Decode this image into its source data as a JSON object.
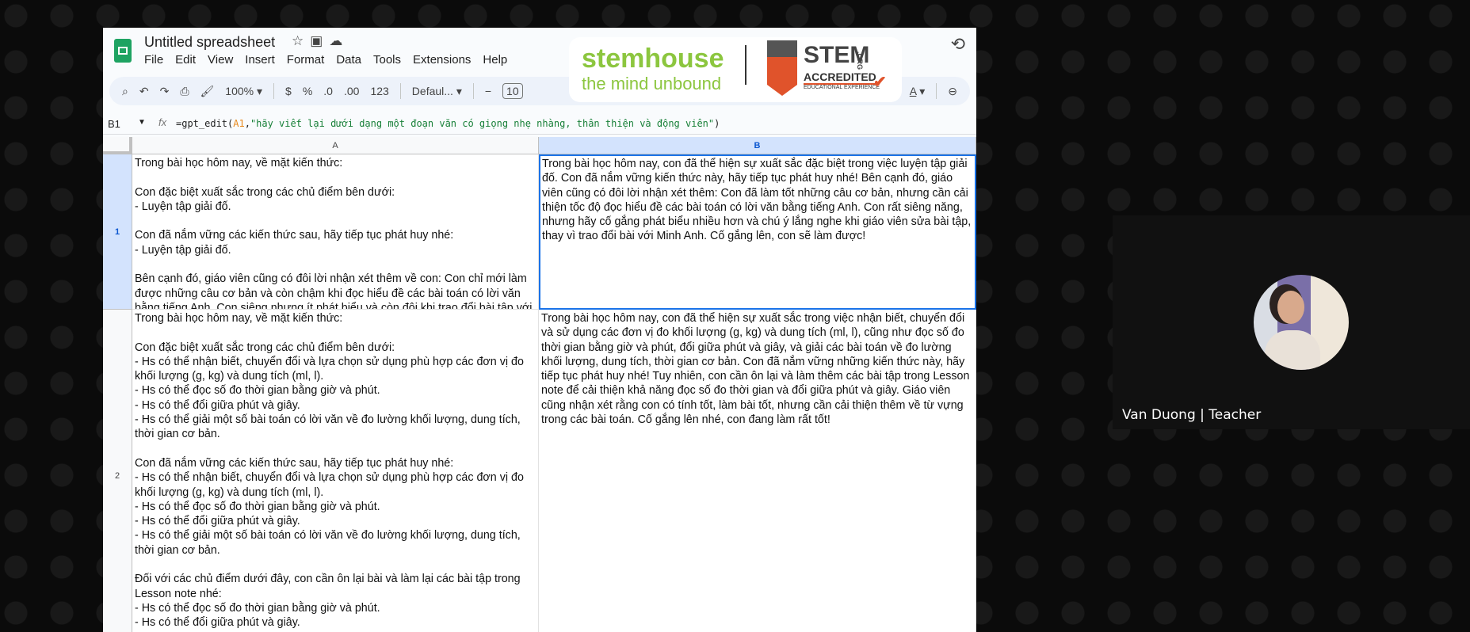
{
  "app": {
    "title": "Untitled spreadsheet",
    "title_icons": [
      "star-icon",
      "folder-move-icon",
      "cloud-status-icon"
    ],
    "menu": [
      "File",
      "Edit",
      "View",
      "Insert",
      "Format",
      "Data",
      "Tools",
      "Extensions",
      "Help"
    ]
  },
  "toolbar": {
    "zoom": "100%",
    "currency": "$",
    "percent": "%",
    "decrease_decimal": ".0",
    "increase_decimal": ".00",
    "number_format": "123",
    "font": "Defaul...",
    "minus": "−",
    "font_size": "10",
    "text_color": "A"
  },
  "overlay": {
    "brand": "stemhouse",
    "tagline": "the mind unbound",
    "stem": "STEM",
    "accredited": "ACCREDITED",
    "edu": "EDUCATIONAL EXPERIENCE",
    "org": ".ORG",
    "brand_color": "#8cc63f",
    "accent_color": "#e0532b"
  },
  "formula_bar": {
    "cell_ref": "B1",
    "fx": "fx",
    "prefix": "=gpt_edit(",
    "ref": "A1",
    "comma": ",",
    "string": "\"hãy viết lại dưới dạng một đoạn văn có giọng nhẹ nhàng, thân thiện và động viên\"",
    "suffix": ")"
  },
  "grid": {
    "columns": [
      "A",
      "B"
    ],
    "rows": [
      {
        "num": "1",
        "a": "Trong bài học hôm nay, về mặt kiến thức:\n\nCon đặc biệt xuất sắc trong các chủ điểm bên dưới:\n- Luyện tập giải đố.\n\nCon đã nắm vững các kiến thức sau, hãy tiếp tục phát huy nhé:\n- Luyện tập giải đố.\n\nBên cạnh đó, giáo viên cũng có đôi lời nhận xét thêm về con: Con chỉ mới làm được những câu cơ bản và còn chậm khi đọc hiểu đề các bài toán có lời văn bằng tiếng Anh. Con siêng nhưng ít phát biểu và còn đôi khi trao đổi bài tập với Minh Anh nên chưa chú ý nghe GV sửa bài tập.",
        "b": "Trong bài học hôm nay, con đã thể hiện sự xuất sắc đặc biệt trong việc luyện tập giải đố. Con đã nắm vững kiến thức này, hãy tiếp tục phát huy nhé! Bên cạnh đó, giáo viên cũng có đôi lời nhận xét thêm: Con đã làm tốt những câu cơ bản, nhưng cần cải thiện tốc độ đọc hiểu đề các bài toán có lời văn bằng tiếng Anh. Con rất siêng năng, nhưng hãy cố gắng phát biểu nhiều hơn và chú ý lắng nghe khi giáo viên sửa bài tập, thay vì trao đổi bài với Minh Anh. Cố gắng lên, con sẽ làm được!"
      },
      {
        "num": "2",
        "a": "Trong bài học hôm nay, về mặt kiến thức:\n\nCon đặc biệt xuất sắc trong các chủ điểm bên dưới:\n- Hs có thể nhận biết, chuyển đổi và lựa chọn sử dụng phù hợp các đơn vị đo khối lượng (g, kg) và dung tích (ml, l).\n- Hs có thể đọc số đo thời gian bằng giờ và phút.\n- Hs có thể đổi giữa phút và giây.\n- Hs có thể giải một số bài toán có lời văn về đo lường khối lượng, dung tích, thời gian cơ bản.\n\nCon đã nắm vững các kiến thức sau, hãy tiếp tục phát huy nhé:\n- Hs có thể nhận biết, chuyển đổi và lựa chọn sử dụng phù hợp các đơn vị đo khối lượng (g, kg) và dung tích (ml, l).\n- Hs có thể đọc số đo thời gian bằng giờ và phút.\n- Hs có thể đổi giữa phút và giây.\n- Hs có thể giải một số bài toán có lời văn về đo lường khối lượng, dung tích, thời gian cơ bản.\n\nĐối với các chủ điểm dưới đây, con cần ôn lại bài và làm lại các bài tập trong Lesson note nhé:\n- Hs có thể đọc số đo thời gian bằng giờ và phút.\n- Hs có thể đổi giữa phút và giây.\n\nBên cạnh đó, giáo viên cũng có đôi lời nhận xét thêm về con: tính tốt, làm bài tốt, từ vựng bài toán còn kém",
        "b": "Trong bài học hôm nay, con đã thể hiện sự xuất sắc trong việc nhận biết, chuyển đổi và sử dụng các đơn vị đo khối lượng (g, kg) và dung tích (ml, l), cũng như đọc số đo thời gian bằng giờ và phút, đổi giữa phút và giây, và giải các bài toán về đo lường khối lượng, dung tích, thời gian cơ bản. Con đã nắm vững những kiến thức này, hãy tiếp tục phát huy nhé! Tuy nhiên, con cần ôn lại và làm thêm các bài tập trong Lesson note để cải thiện khả năng đọc số đo thời gian và đổi giữa phút và giây. Giáo viên cũng nhận xét rằng con có tính tốt, làm bài tốt, nhưng cần cải thiện thêm về từ vựng trong các bài toán. Cố gắng lên nhé, con đang làm rất tốt!"
      }
    ]
  },
  "camera": {
    "name": "Van Duong | Teacher"
  }
}
